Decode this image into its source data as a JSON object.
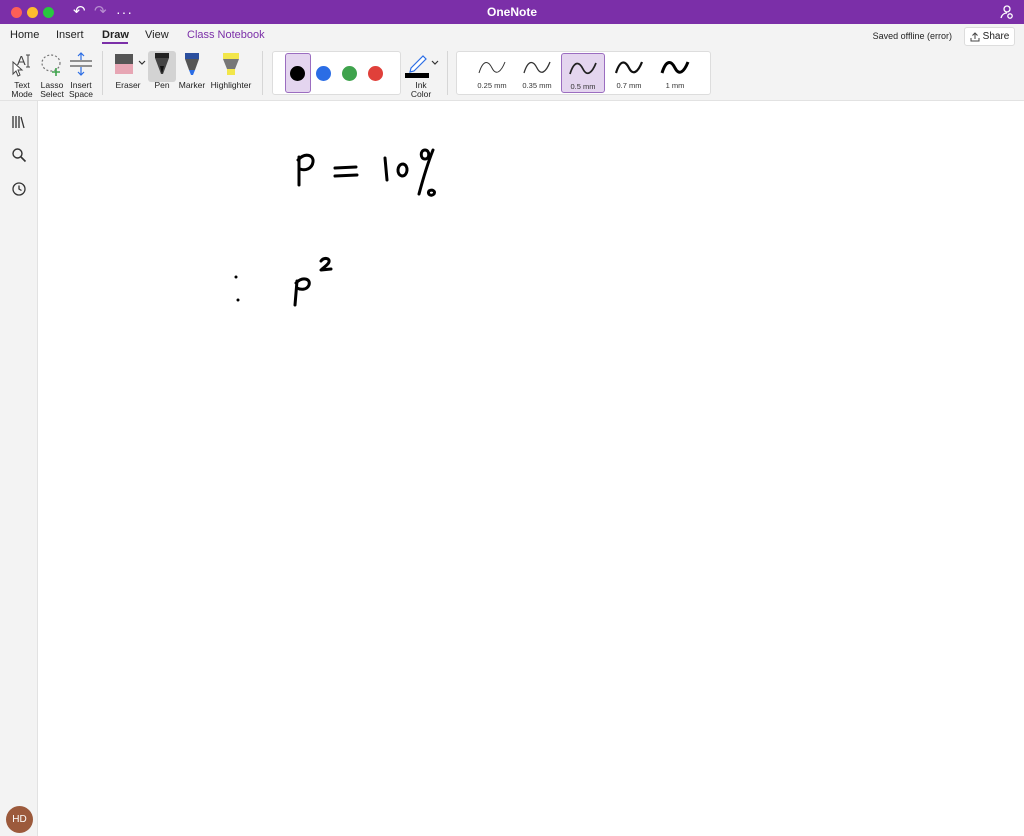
{
  "app": {
    "title": "OneNote",
    "status": "Saved offline (error)",
    "share_label": "Share"
  },
  "tabs": [
    {
      "label": "Home"
    },
    {
      "label": "Insert"
    },
    {
      "label": "Draw"
    },
    {
      "label": "View"
    },
    {
      "label": "Class Notebook"
    }
  ],
  "toolbar": {
    "text_mode": [
      "Text",
      "Mode"
    ],
    "lasso_select": [
      "Lasso",
      "Select"
    ],
    "insert_space": [
      "Insert",
      "Space"
    ],
    "eraser": "Eraser",
    "pen": "Pen",
    "marker": "Marker",
    "highlighter": "Highlighter",
    "ink_color": [
      "Ink",
      "Color"
    ]
  },
  "colors": {
    "accent": "#7b2fa8",
    "swatches": [
      "#000000",
      "#2b6de5",
      "#3fa34d",
      "#e0403a"
    ],
    "selected_swatch": 0
  },
  "widths": [
    "0.25 mm",
    "0.35 mm",
    "0.5 mm",
    "0.7 mm",
    "1 mm"
  ],
  "selected_width": "0.5 mm",
  "user": {
    "initials": "HD"
  }
}
